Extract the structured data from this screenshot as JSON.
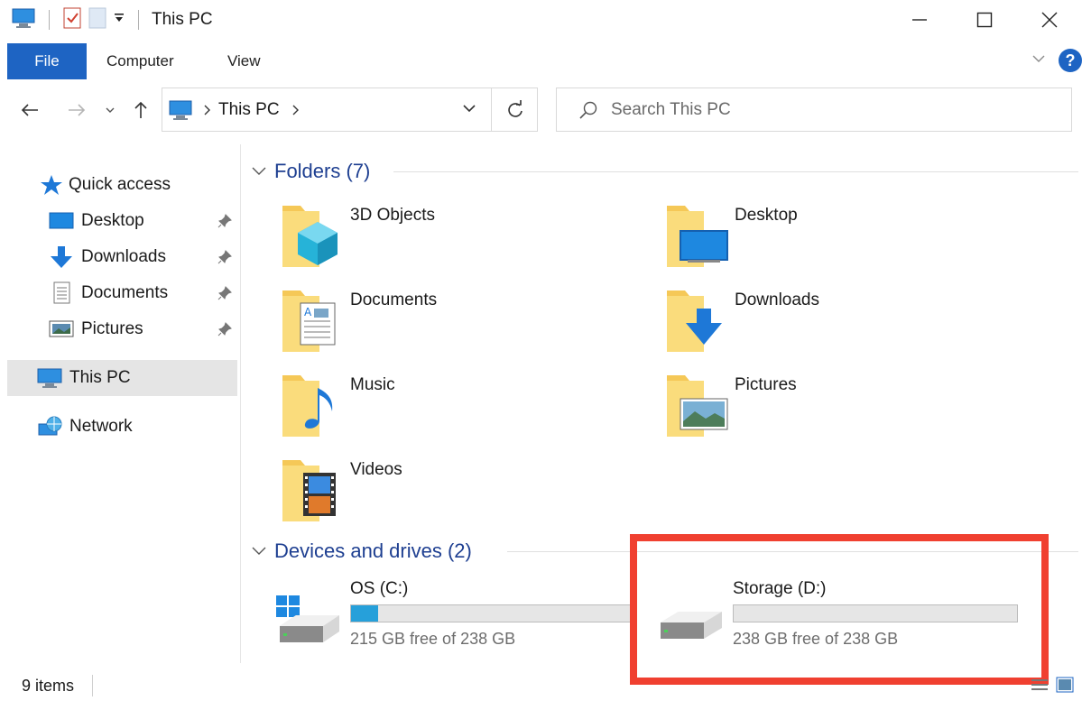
{
  "window": {
    "title": "This PC"
  },
  "ribbon": {
    "file": "File",
    "computer": "Computer",
    "view": "View",
    "help": "?"
  },
  "address": {
    "crumb": "This PC",
    "search_placeholder": "Search This PC"
  },
  "sidebar": {
    "items": [
      {
        "label": "Quick access"
      },
      {
        "label": "Desktop"
      },
      {
        "label": "Downloads"
      },
      {
        "label": "Documents"
      },
      {
        "label": "Pictures"
      },
      {
        "label": "This PC"
      },
      {
        "label": "Network"
      }
    ]
  },
  "folders": {
    "header": "Folders (7)",
    "items": [
      {
        "label": "3D Objects"
      },
      {
        "label": "Desktop"
      },
      {
        "label": "Documents"
      },
      {
        "label": "Downloads"
      },
      {
        "label": "Music"
      },
      {
        "label": "Pictures"
      },
      {
        "label": "Videos"
      }
    ]
  },
  "drives": {
    "header": "Devices and drives (2)",
    "items": [
      {
        "label": "OS (C:)",
        "free": "215 GB free of 238 GB",
        "used_fraction": 0.097
      },
      {
        "label": "Storage (D:)",
        "free": "238 GB free of 238 GB",
        "used_fraction": 0.0
      }
    ]
  },
  "status": {
    "count": "9 items"
  },
  "colors": {
    "accent": "#1e64c3",
    "header": "#1e3f91",
    "bar_fill": "#26a0da",
    "highlight": "#f04030",
    "folder": "#f5c857"
  }
}
